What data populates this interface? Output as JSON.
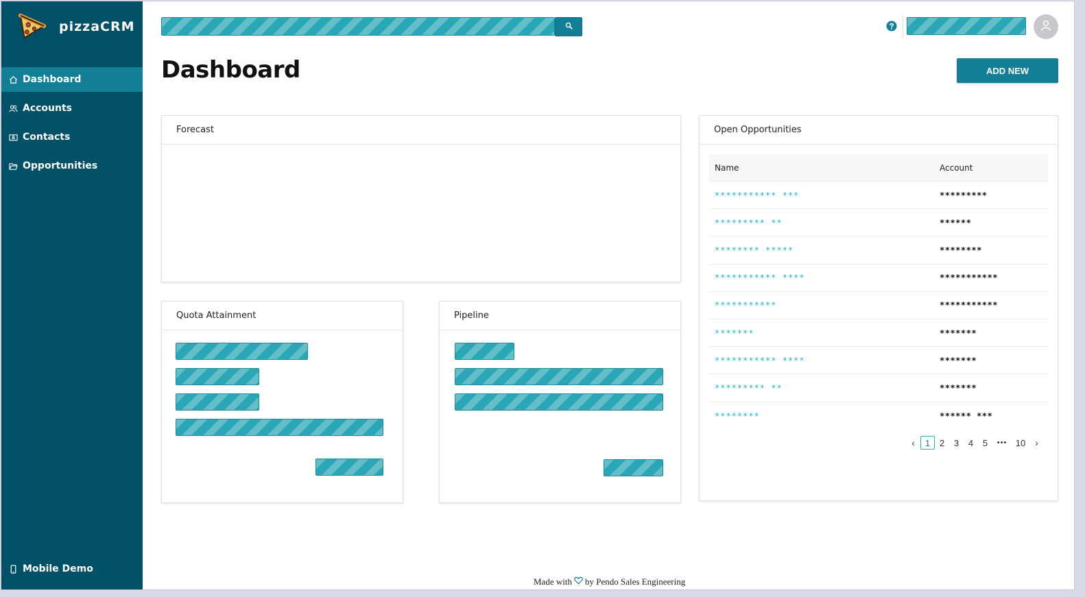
{
  "app": {
    "name": "pizzaCRM"
  },
  "sidebar": {
    "items": [
      {
        "label": "Dashboard",
        "icon": "home-icon",
        "active": true
      },
      {
        "label": "Accounts",
        "icon": "users-icon",
        "active": false
      },
      {
        "label": "Contacts",
        "icon": "contact-card-icon",
        "active": false
      },
      {
        "label": "Opportunities",
        "icon": "folder-open-icon",
        "active": false
      }
    ],
    "bottom_label": "Mobile Demo"
  },
  "header": {
    "page_title": "Dashboard",
    "add_new_label": "ADD NEW"
  },
  "cards": {
    "forecast_title": "Forecast",
    "quota_title": "Quota Attainment",
    "pipeline_title": "Pipeline",
    "opps_title": "Open Opportunities"
  },
  "opportunities": {
    "columns": [
      "Name",
      "Account"
    ],
    "rows": [
      {
        "name": "*********** ***",
        "account": "*********"
      },
      {
        "name": "********* **",
        "account": "******"
      },
      {
        "name": "******** *****",
        "account": "********"
      },
      {
        "name": "*********** ****",
        "account": "***********"
      },
      {
        "name": "***********",
        "account": "***********"
      },
      {
        "name": "*******",
        "account": "*******"
      },
      {
        "name": "*********** ****",
        "account": "*******"
      },
      {
        "name": "*********  **",
        "account": "*******"
      },
      {
        "name": "********",
        "account": "****** ***"
      }
    ]
  },
  "pagination": {
    "prev": "‹",
    "pages": [
      "1",
      "2",
      "3",
      "4",
      "5"
    ],
    "ellipsis": "•••",
    "last": "10",
    "next": "›",
    "current": "1"
  },
  "footer": {
    "made_with": "Made with",
    "by_text": "by Pendo Sales Engineering"
  },
  "colors": {
    "sidebar_bg": "#005167",
    "accent": "#137f97",
    "link": "#1ab3c9",
    "placeholder_hatch": "#2aa7b7"
  }
}
